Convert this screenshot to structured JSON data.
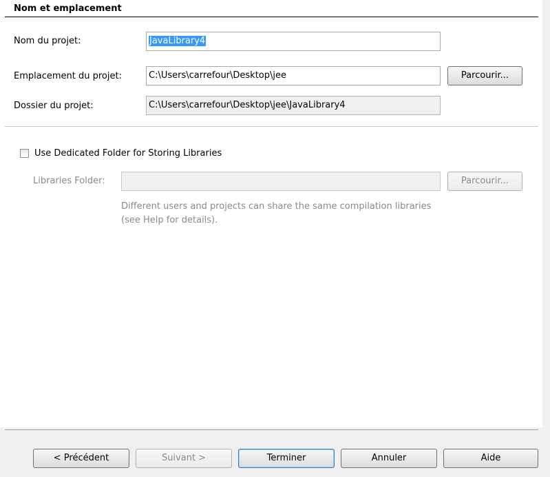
{
  "section": {
    "title": "Nom et emplacement"
  },
  "project_name": {
    "label": "Nom du projet:",
    "value": "JavaLibrary4"
  },
  "project_location": {
    "label": "Emplacement du projet:",
    "value": "C:\\Users\\carrefour\\Desktop\\jee",
    "browse": "Parcourir..."
  },
  "project_folder": {
    "label": "Dossier du projet:",
    "value": "C:\\Users\\carrefour\\Desktop\\jee\\JavaLibrary4"
  },
  "dedicated_folder": {
    "label": "Use Dedicated Folder for Storing Libraries",
    "checked": false
  },
  "libraries_folder": {
    "label": "Libraries Folder:",
    "value": "",
    "browse": "Parcourir..."
  },
  "help_text": "Different users and projects can share the same compilation libraries (see Help for details).",
  "buttons": {
    "previous": "< Précédent",
    "next": "Suivant >",
    "finish": "Terminer",
    "cancel": "Annuler",
    "help": "Aide"
  }
}
